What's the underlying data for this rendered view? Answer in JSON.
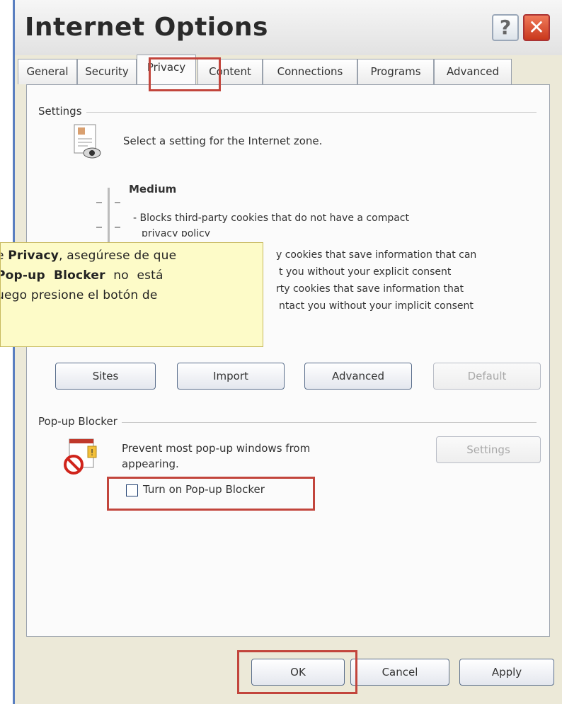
{
  "window": {
    "title": "Internet Options",
    "help_symbol": "?",
    "close_symbol": "✕"
  },
  "tabs": [
    {
      "label": "General"
    },
    {
      "label": "Security"
    },
    {
      "label": "Privacy",
      "active": true
    },
    {
      "label": "Content"
    },
    {
      "label": "Connections"
    },
    {
      "label": "Programs"
    },
    {
      "label": "Advanced"
    }
  ],
  "settings": {
    "group_label": "Settings",
    "description": "Select a setting for the Internet zone.",
    "level": "Medium",
    "bullets": [
      "- Blocks third-party cookies that do not have a compact",
      "privacy policy",
      "y cookies that save information that can",
      "t you without your explicit consent",
      "rty cookies that save information that",
      "ntact you without your implicit consent"
    ],
    "buttons": {
      "sites": "Sites",
      "import": "Import",
      "advanced": "Advanced",
      "default": "Default"
    }
  },
  "popup": {
    "group_label": "Pop-up Blocker",
    "description_line1": "Prevent most pop-up windows from",
    "description_line2": "appearing.",
    "settings_button": "Settings",
    "checkbox_label": "Turn on Pop-up Blocker",
    "checkbox_checked": false
  },
  "footer": {
    "ok": "OK",
    "cancel": "Cancel",
    "apply": "Apply"
  },
  "callout": {
    "line1_pre": "e ",
    "line1_bold": "Privacy",
    "line1_post": ", asegúrese de que",
    "line2_bold": "Pop-up Blocker",
    "line2_post": " no está",
    "line3": "uego presione el botón de"
  },
  "colors": {
    "highlight_red": "#c2453c",
    "callout_bg": "#fdfbc8",
    "window_bg": "#ece9d8"
  }
}
